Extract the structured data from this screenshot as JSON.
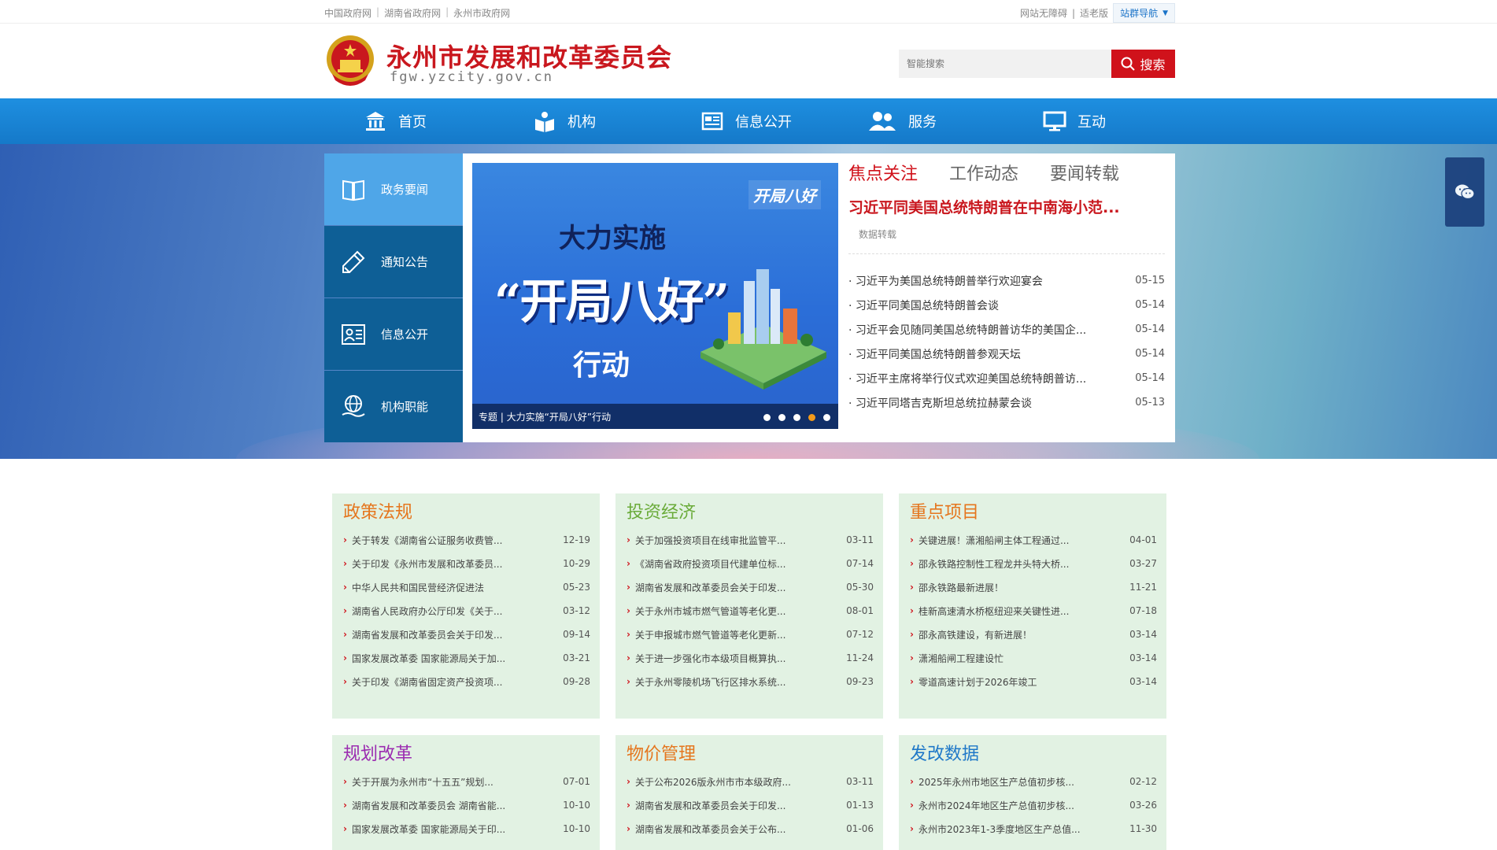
{
  "topbar": {
    "links": [
      "中国政府网",
      "湖南省政府网",
      "永州市政府网"
    ],
    "accessibility": "网站无障碍",
    "elder": "适老版",
    "site_nav": "站群导航"
  },
  "header": {
    "title": "永州市发展和改革委员会",
    "domain": "fgw.yzcity.gov.cn",
    "search_placeholder": "智能搜索",
    "search_button": "搜索"
  },
  "nav": {
    "items": [
      {
        "label": "首页",
        "icon": "home-icon"
      },
      {
        "label": "机构",
        "icon": "org-icon"
      },
      {
        "label": "信息公开",
        "icon": "info-icon"
      },
      {
        "label": "服务",
        "icon": "users-icon"
      },
      {
        "label": "互动",
        "icon": "monitor-icon"
      }
    ]
  },
  "side_tabs": [
    {
      "label": "政务要闻",
      "icon": "book-icon"
    },
    {
      "label": "通知公告",
      "icon": "pen-icon"
    },
    {
      "label": "信息公开",
      "icon": "id-card-icon"
    },
    {
      "label": "机构职能",
      "icon": "globe-hand-icon"
    }
  ],
  "banner": {
    "logo": "开局八好",
    "line1": "大力实施",
    "line2": "“开局八好”",
    "line3": "行动",
    "caption": "专题 | 大力实施“开局八好”行动",
    "slide_count": 5,
    "active_slide": 4
  },
  "news": {
    "tabs": [
      "焦点关注",
      "工作动态",
      "要闻转载"
    ],
    "headline": "习近平同美国总统特朗普在中南海小范...",
    "headline_source": "数据转载",
    "items": [
      {
        "title": "· 习近平为美国总统特朗普举行欢迎宴会",
        "date": "05-15"
      },
      {
        "title": "· 习近平同美国总统特朗普会谈",
        "date": "05-14"
      },
      {
        "title": "· 习近平会见随同美国总统特朗普访华的美国企...",
        "date": "05-14"
      },
      {
        "title": "· 习近平同美国总统特朗普参观天坛",
        "date": "05-14"
      },
      {
        "title": "· 习近平主席将举行仪式欢迎美国总统特朗普访...",
        "date": "05-14"
      },
      {
        "title": "· 习近平同塔吉克斯坦总统拉赫蒙会谈",
        "date": "05-13"
      }
    ]
  },
  "cards": [
    {
      "title": "政策法规",
      "color": "#e5761e",
      "items": [
        {
          "title": "关于转发《湖南省公证服务收费管...",
          "date": "12-19"
        },
        {
          "title": "关于印发《永州市发展和改革委员...",
          "date": "10-29"
        },
        {
          "title": "中华人民共和国民营经济促进法",
          "date": "05-23"
        },
        {
          "title": "湖南省人民政府办公厅印发《关于...",
          "date": "03-12"
        },
        {
          "title": "湖南省发展和改革委员会关于印发...",
          "date": "09-14"
        },
        {
          "title": "国家发展改革委 国家能源局关于加...",
          "date": "03-21"
        },
        {
          "title": "关于印发《湖南省固定资产投资项...",
          "date": "09-28"
        }
      ]
    },
    {
      "title": "投资经济",
      "color": "#6aab39",
      "items": [
        {
          "title": "关于加强投资项目在线审批监管平...",
          "date": "03-11"
        },
        {
          "title": "《湖南省政府投资项目代建单位标...",
          "date": "07-14"
        },
        {
          "title": "湖南省发展和改革委员会关于印发...",
          "date": "05-30"
        },
        {
          "title": "关于永州市城市燃气管道等老化更...",
          "date": "08-01"
        },
        {
          "title": "关于申报城市燃气管道等老化更新...",
          "date": "07-12"
        },
        {
          "title": "关于进一步强化市本级项目概算执...",
          "date": "11-24"
        },
        {
          "title": "关于永州零陵机场飞行区排水系统...",
          "date": "09-23"
        }
      ]
    },
    {
      "title": "重点项目",
      "color": "#e5761e",
      "items": [
        {
          "title": "关键进展！潇湘船闸主体工程通过...",
          "date": "04-01"
        },
        {
          "title": "邵永铁路控制性工程龙井头特大桥...",
          "date": "03-27"
        },
        {
          "title": "邵永铁路最新进展！",
          "date": "11-21"
        },
        {
          "title": "桂新高速清水桥枢纽迎来关键性进...",
          "date": "07-18"
        },
        {
          "title": "邵永高铁建设，有新进展！",
          "date": "03-14"
        },
        {
          "title": "潇湘船闸工程建设忙",
          "date": "03-14"
        },
        {
          "title": "零道高速计划于2026年竣工",
          "date": "03-14"
        }
      ]
    },
    {
      "title": "规划改革",
      "color": "#9b2bb0",
      "items": [
        {
          "title": "关于开展为永州市“十五五”规划...",
          "date": "07-01"
        },
        {
          "title": "湖南省发展和改革委员会 湖南省能...",
          "date": "10-10"
        },
        {
          "title": "国家发展改革委 国家能源局关于印...",
          "date": "10-10"
        }
      ]
    },
    {
      "title": "物价管理",
      "color": "#e5761e",
      "items": [
        {
          "title": "关于公布2026版永州市市本级政府...",
          "date": "03-11"
        },
        {
          "title": "湖南省发展和改革委员会关于印发...",
          "date": "01-13"
        },
        {
          "title": "湖南省发展和改革委员会关于公布...",
          "date": "01-06"
        }
      ]
    },
    {
      "title": "发改数据",
      "color": "#1f78c8",
      "items": [
        {
          "title": "2025年永州市地区生产总值初步核...",
          "date": "02-12"
        },
        {
          "title": "永州市2024年地区生产总值初步核...",
          "date": "03-26"
        },
        {
          "title": "永州市2023年1-3季度地区生产总值...",
          "date": "11-30"
        }
      ]
    }
  ]
}
